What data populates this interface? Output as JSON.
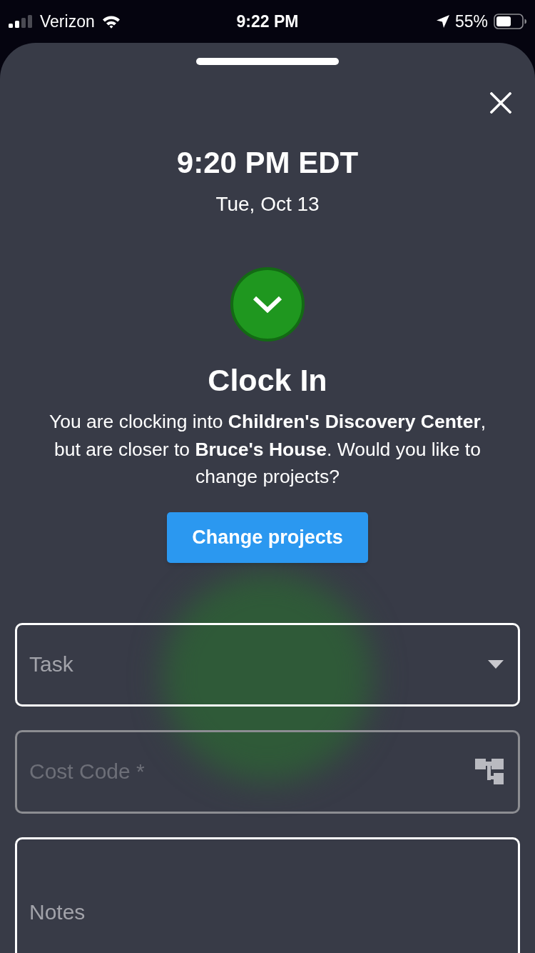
{
  "status_bar": {
    "carrier": "Verizon",
    "time": "9:22 PM",
    "battery": "55%"
  },
  "clock": {
    "time": "9:20 PM EDT",
    "date": "Tue, Oct 13"
  },
  "dialog": {
    "title": "Clock In",
    "message": "You are clocking into **Children's Discovery Center**, but are closer to **Bruce's House**. Would you like to change projects?",
    "button": "Change projects"
  },
  "fields": [
    {
      "kind": "dropdown",
      "placeholder": "Task",
      "disabled": false
    },
    {
      "kind": "picker",
      "placeholder": "Cost Code *",
      "disabled": true
    },
    {
      "kind": "textarea",
      "placeholder": "Notes",
      "disabled": false
    }
  ]
}
